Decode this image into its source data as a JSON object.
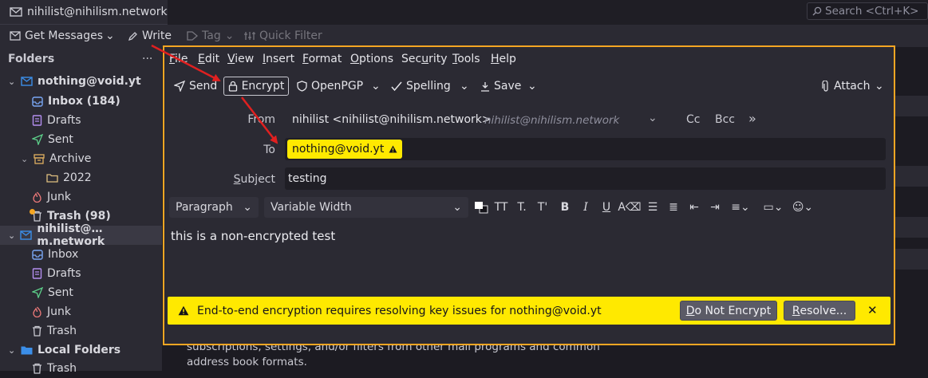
{
  "tab": {
    "title": "nihilist@nihilism.network"
  },
  "toolbar": {
    "get_messages": "Get Messages",
    "write": "Write",
    "tag": "Tag",
    "quick_filter": "Quick Filter",
    "search_placeholder": "Search <Ctrl+K>"
  },
  "folders": {
    "header": "Folders",
    "menu": "···",
    "accounts": [
      {
        "name": "nothing@void.yt",
        "items": [
          {
            "label": "Inbox (184)",
            "icon": "inbox-icon"
          },
          {
            "label": "Drafts",
            "icon": "drafts-icon"
          },
          {
            "label": "Sent",
            "icon": "sent-icon"
          },
          {
            "label": "Archive",
            "icon": "archive-icon"
          },
          {
            "label": "2022",
            "icon": "folder-icon"
          },
          {
            "label": "Junk",
            "icon": "junk-icon"
          },
          {
            "label": "Trash (98)",
            "icon": "trash-icon"
          }
        ]
      },
      {
        "name": "nihilist@…m.network",
        "items": [
          {
            "label": "Inbox",
            "icon": "inbox-icon"
          },
          {
            "label": "Drafts",
            "icon": "drafts-icon"
          },
          {
            "label": "Sent",
            "icon": "sent-icon"
          },
          {
            "label": "Junk",
            "icon": "junk-icon"
          },
          {
            "label": "Trash",
            "icon": "trash-icon"
          }
        ]
      },
      {
        "name": "Local Folders",
        "items": [
          {
            "label": "Trash",
            "icon": "trash-icon"
          }
        ]
      }
    ]
  },
  "compose": {
    "menu": {
      "file": {
        "u": "F",
        "rest": "ile"
      },
      "edit": {
        "u": "E",
        "rest": "dit"
      },
      "view": {
        "u": "V",
        "rest": "iew"
      },
      "insert": {
        "u": "I",
        "rest": "nsert"
      },
      "format": {
        "u": "F",
        "rest": "ormat"
      },
      "options": {
        "u": "O",
        "rest": "ptions"
      },
      "security": {
        "pre": "Sec",
        "u": "u",
        "rest": "rity"
      },
      "tools": {
        "u": "T",
        "rest": "ools"
      },
      "help": {
        "u": "H",
        "rest": "elp"
      }
    },
    "buttons": {
      "send": "Send",
      "encrypt": "Encrypt",
      "openpgp": "OpenPGP",
      "spelling": "Spelling",
      "save": "Save",
      "attach": "Attach"
    },
    "from": {
      "label": "From",
      "value": "nihilist <nihilist@nihilism.network>",
      "identity": "nihilist@nihilism.network",
      "cc": "Cc",
      "bcc": "Bcc",
      "more": "»"
    },
    "to": {
      "label": "To",
      "recipient": "nothing@void.yt"
    },
    "subject": {
      "label_u": "S",
      "label_rest": "ubject",
      "value": "testing"
    },
    "format_bar": {
      "paragraph": "Paragraph",
      "font": "Variable Width"
    },
    "body_text": "this is a non-encrypted test",
    "notice": {
      "message": "End-to-end encryption requires resolving key issues for nothing@void.yt",
      "do_not_encrypt_u": "D",
      "do_not_encrypt_rest": "o Not Encrypt",
      "resolve_u": "R",
      "resolve_rest": "esolve...",
      "close": "✕"
    }
  },
  "background": {
    "text_line1": "subscriptions, settings, and/or filters from other mail programs and common",
    "text_line2": "address book formats."
  },
  "colors": {
    "highlight_border": "#f5a623",
    "warning_yellow": "#ffe900",
    "annotation_arrow": "#e02020",
    "accent_blue": "#3b8ee8"
  }
}
